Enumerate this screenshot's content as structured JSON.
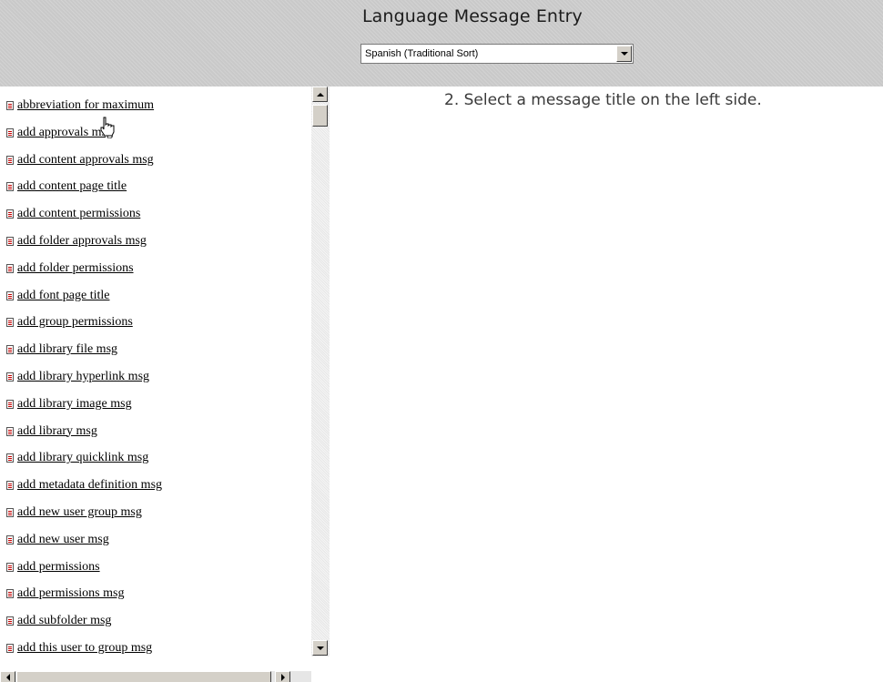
{
  "header": {
    "title": "Language Message Entry",
    "language_select": {
      "selected": "Spanish (Traditional Sort)"
    }
  },
  "message_list": {
    "items": [
      {
        "label": "abbreviation for maximum"
      },
      {
        "label": "add approvals msg"
      },
      {
        "label": "add content approvals msg"
      },
      {
        "label": "add content page title"
      },
      {
        "label": "add content permissions"
      },
      {
        "label": "add folder approvals msg"
      },
      {
        "label": "add folder permissions"
      },
      {
        "label": "add font page title"
      },
      {
        "label": "add group permissions"
      },
      {
        "label": "add library file msg"
      },
      {
        "label": "add library hyperlink msg"
      },
      {
        "label": "add library image msg"
      },
      {
        "label": "add library msg"
      },
      {
        "label": "add library quicklink msg"
      },
      {
        "label": "add metadata definition msg"
      },
      {
        "label": "add new user group msg"
      },
      {
        "label": "add new user msg"
      },
      {
        "label": "add permissions"
      },
      {
        "label": "add permissions msg"
      },
      {
        "label": "add subfolder msg"
      },
      {
        "label": "add this user to group msg"
      }
    ]
  },
  "main": {
    "instruction": "2. Select a message title on the left side."
  },
  "icons": {
    "list_item_icon": "document-icon",
    "dropdown_icon": "chevron-down-icon",
    "cursor_icon": "hand-pointer-icon"
  }
}
